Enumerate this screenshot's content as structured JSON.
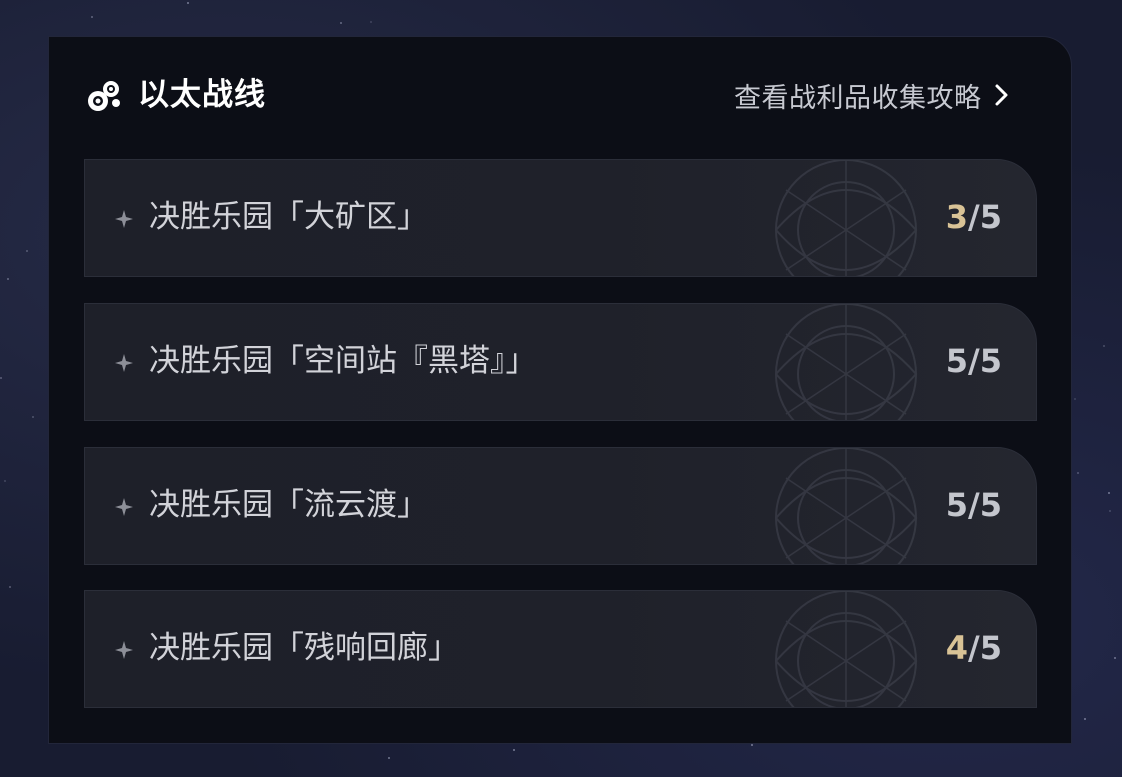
{
  "header": {
    "title": "以太战线",
    "icon": "ether-orbs-icon",
    "guide_link": "查看战利品收集攻略",
    "guide_icon": "chevron-right-icon"
  },
  "colors": {
    "panel_bg": "#0c0e16",
    "row_bg": "#1f212a",
    "accent_incomplete": "#d9c396",
    "text_primary": "#d2d3d9"
  },
  "rows": [
    {
      "label": "决胜乐园「大矿区」",
      "current": "3",
      "separator": "/",
      "total": "5",
      "complete": false
    },
    {
      "label": "决胜乐园「空间站『黑塔』」",
      "current": "5",
      "separator": "/",
      "total": "5",
      "complete": true
    },
    {
      "label": "决胜乐园「流云渡」",
      "current": "5",
      "separator": "/",
      "total": "5",
      "complete": true
    },
    {
      "label": "决胜乐园「残响回廊」",
      "current": "4",
      "separator": "/",
      "total": "5",
      "complete": false
    }
  ]
}
